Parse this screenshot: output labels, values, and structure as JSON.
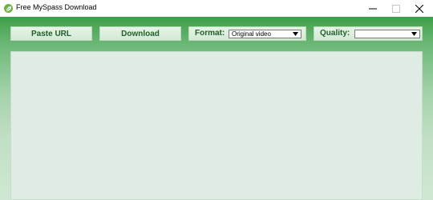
{
  "window": {
    "title": "Free MySpass Download",
    "app_icon": "leaf-icon",
    "controls": [
      "minimize-icon",
      "maximize-icon",
      "close-icon"
    ]
  },
  "toolbar": {
    "paste_url_label": "Paste URL",
    "download_label": "Download",
    "format_label": "Format:",
    "format_value": "Original video",
    "quality_label": "Quality:",
    "quality_value": ""
  },
  "colors": {
    "accent_green": "#3d9d48",
    "button_text": "#1f5e28",
    "panel_background": "#dfece3"
  }
}
